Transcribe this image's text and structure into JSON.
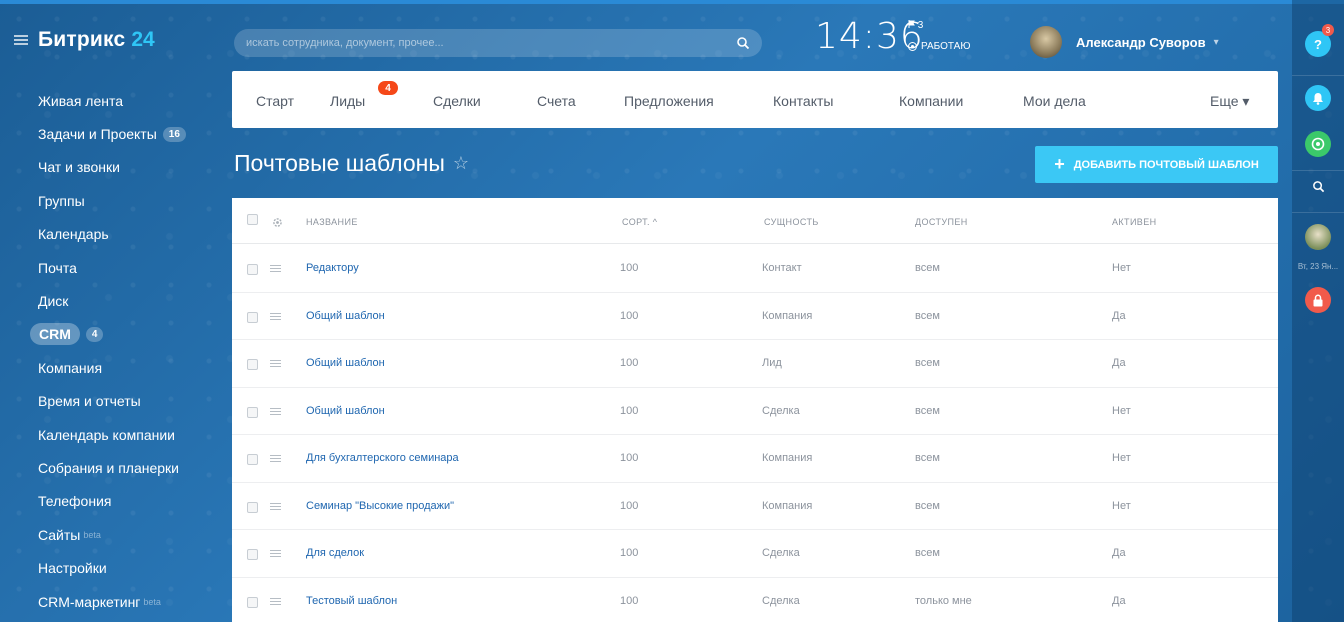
{
  "app": {
    "logo": "Битрикс",
    "logo_num": "24"
  },
  "sidebar": {
    "items": [
      {
        "label": "Живая лента"
      },
      {
        "label": "Задачи и Проекты",
        "badge": "16"
      },
      {
        "label": "Чат и звонки"
      },
      {
        "label": "Группы"
      },
      {
        "label": "Календарь"
      },
      {
        "label": "Почта"
      },
      {
        "label": "Диск"
      },
      {
        "label": "CRM",
        "badge": "4"
      },
      {
        "label": "Компания"
      },
      {
        "label": "Время и отчеты"
      },
      {
        "label": "Календарь компании"
      },
      {
        "label": "Собрания и планерки"
      },
      {
        "label": "Телефония"
      },
      {
        "label": "Сайты",
        "beta": "beta"
      },
      {
        "label": "Настройки"
      },
      {
        "label": "CRM-маркетинг",
        "beta": "beta"
      }
    ]
  },
  "header": {
    "search_placeholder": "искать сотрудника, документ, прочее...",
    "clock": "14:36",
    "flag_count": "3",
    "work_status": "РАБОТАЮ",
    "user_name": "Александр Суворов",
    "user_caret": "▾"
  },
  "rail": {
    "help_label": "?",
    "help_badge": "3",
    "date_label": "Вт, 23 Ян..."
  },
  "topnav": {
    "items": [
      "Старт",
      "Лиды",
      "Сделки",
      "Счета",
      "Предложения",
      "Контакты",
      "Компании",
      "Мои дела",
      "Еще ▾"
    ],
    "leads_badge": "4"
  },
  "page": {
    "title": "Почтовые шаблоны",
    "star": "☆",
    "add_button": "добавить почтовый шаблон",
    "add_plus": "+"
  },
  "table": {
    "headers": {
      "name": "Название",
      "sort": "Сорт. ^",
      "entity": "Сущность",
      "access": "Доступен",
      "active": "Активен"
    },
    "rows": [
      {
        "name": "Редактору",
        "sort": "100",
        "entity": "Контакт",
        "access": "всем",
        "active": "Нет"
      },
      {
        "name": "Общий шаблон",
        "sort": "100",
        "entity": "Компания",
        "access": "всем",
        "active": "Да"
      },
      {
        "name": "Общий шаблон",
        "sort": "100",
        "entity": "Лид",
        "access": "всем",
        "active": "Да"
      },
      {
        "name": "Общий шаблон",
        "sort": "100",
        "entity": "Сделка",
        "access": "всем",
        "active": "Нет"
      },
      {
        "name": "Для бухгалтерского семинара",
        "sort": "100",
        "entity": "Компания",
        "access": "всем",
        "active": "Нет"
      },
      {
        "name": "Семинар \"Высокие продажи\"",
        "sort": "100",
        "entity": "Компания",
        "access": "всем",
        "active": "Нет"
      },
      {
        "name": "Для сделок",
        "sort": "100",
        "entity": "Сделка",
        "access": "всем",
        "active": "Да"
      },
      {
        "name": "Тестовый шаблон",
        "sort": "100",
        "entity": "Сделка",
        "access": "только мне",
        "active": "Да"
      }
    ]
  },
  "colors": {
    "accent": "#3bc8f5",
    "link": "#2067b0",
    "badge_red": "#f54819"
  }
}
